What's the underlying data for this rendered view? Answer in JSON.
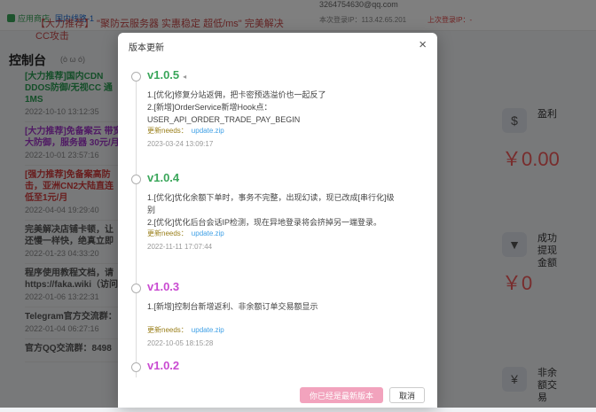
{
  "background": {
    "app_tag": "应用商店",
    "route_tag": "国内线路-1",
    "top_email": "3264754630@qq.com",
    "top_login": "本次登录IP：113.42.65.201",
    "top_last": "上次登录IP：-",
    "ad_text": "【大力推荐】 \"聚防云服务器 实惠稳定 超低/ms\" 完美解决CC攻击",
    "console_title": "控制台",
    "console_sub": "(ò ω ó)",
    "news": [
      {
        "text": "[大力推荐]国内CDN DDOS防御/无视CC 通1MS",
        "date": "2022-10-10 13:12:35",
        "color": "green"
      },
      {
        "text": "[大力推荐]免备案云 带宽大防御，服务器 30元/月",
        "date": "2022-10-01 23:57:16",
        "color": "purple"
      },
      {
        "text": "[强力推荐]免备案高防 击，亚洲CN2大陆直连 低至1元/月",
        "date": "2022-04-04 19:29:40",
        "color": "red"
      },
      {
        "text": "完美解决店铺卡顿，让 还慢一样快，绝真立即",
        "date": "2022-01-23 04:33:20",
        "color": "gray"
      },
      {
        "text": "程序使用教程文档，请 https://faka.wiki（访问",
        "date": "2022-01-06 13:22:31",
        "color": "gray"
      },
      {
        "text": "Telegram官方交流群：",
        "date": "2022-01-04 06:27:16",
        "color": "gray"
      },
      {
        "text": "官方QQ交流群：8498",
        "date": "",
        "color": "gray"
      }
    ],
    "stats": [
      {
        "label": "盈利",
        "value": "￥0.00",
        "icon": "coin-icon"
      },
      {
        "label": "成功提现金额",
        "value": "￥0",
        "icon": "funnel-icon"
      },
      {
        "label": "非余额交易",
        "value": "",
        "icon": "pay-icon"
      }
    ]
  },
  "modal": {
    "title": "版本更新",
    "close_label": "×",
    "versions": [
      {
        "name": "v1.0.5",
        "flag": "◂",
        "color": "#3aa65a",
        "notes": [
          "1.[优化]修复分站返佣，把卡密预选溢价也一起反了",
          "2.[新增]OrderService新增Hook点：USER_API_ORDER_TRADE_PAY_BEGIN"
        ],
        "file_label": "更新needs：",
        "file_name": "update.zip",
        "date": "2023-03-24 13:09:17"
      },
      {
        "name": "v1.0.4",
        "flag": "",
        "color": "#3aa65a",
        "notes": [
          "1.[优化]优化余额下单时，事务不完整，出现幻读，现已改成[串行化]级别",
          "2.[优化]优化后台会话IP检测，现在异地登录将会挤掉另一端登录。"
        ],
        "file_label": "更新needs：",
        "file_name": "update.zip",
        "date": "2022-11-11 17:07:44"
      },
      {
        "name": "v1.0.3",
        "flag": "",
        "color": "#c94ad1",
        "notes": [
          "1.[新增]控制台新增返利、非余额订单交易额显示"
        ],
        "file_label": "更新needs：",
        "file_name": "update.zip",
        "date": "2022-10-05 18:15:28"
      },
      {
        "name": "v1.0.2",
        "flag": "",
        "color": "#c94ad1",
        "notes": [],
        "file_label": "",
        "file_name": "",
        "date": ""
      }
    ],
    "btn_latest": "你已经是最新版本",
    "btn_cancel": "取消"
  }
}
